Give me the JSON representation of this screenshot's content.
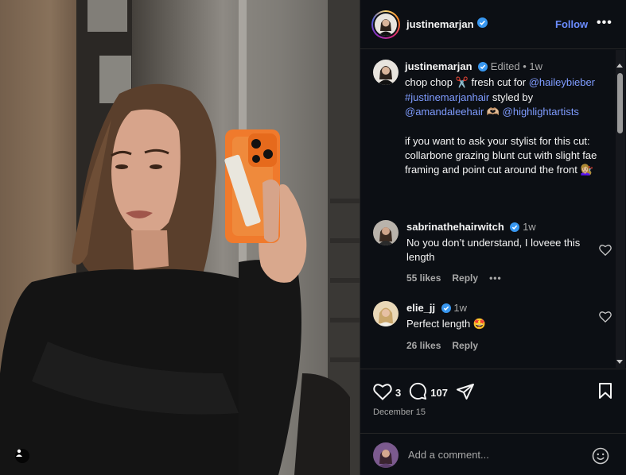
{
  "post": {
    "username": "justinemarjan",
    "follow_label": "Follow",
    "more_label": "•••"
  },
  "caption": {
    "username": "justinemarjan",
    "meta": "Edited • 1w",
    "text_1": "chop chop",
    "scissors_emoji": "✂️",
    "text_2": "fresh cut for",
    "mention_1": "@haileybieber",
    "hashtag": "#justinemarjanhair",
    "text_3": "styled by",
    "mention_2": "@amandaleehair",
    "heart_hands_emoji": "🫶🏼",
    "mention_3": "@highlightartists",
    "paragraph_2": "if you want to ask your stylist for this cut: collarbone grazing blunt cut with slight fae framing and point cut around the front",
    "haircut_emoji": "💇🏼‍♀️"
  },
  "comments": [
    {
      "username": "sabrinathehairwitch",
      "time": "1w",
      "text": "No you don’t understand, I loveee this length",
      "likes": "55 likes",
      "reply_label": "Reply",
      "more_label": "•••"
    },
    {
      "username": "elie_jj",
      "time": "1w",
      "text": "Perfect length",
      "emoji": "🤩",
      "likes": "26 likes",
      "reply_label": "Reply"
    }
  ],
  "stats": {
    "likes": "3",
    "comments": "107"
  },
  "date": "December 15",
  "add_comment": {
    "placeholder": "Add a comment..."
  },
  "colors": {
    "panel_bg": "#0c0f14",
    "link": "#7f9cff",
    "follow": "#6b8cff",
    "verified": "#3897f0",
    "muted": "#a8a8a8"
  },
  "icons": [
    "verified-badge-icon",
    "heart-icon",
    "comment-icon",
    "share-icon",
    "bookmark-icon",
    "emoji-icon",
    "user-tag-icon",
    "more-icon"
  ]
}
